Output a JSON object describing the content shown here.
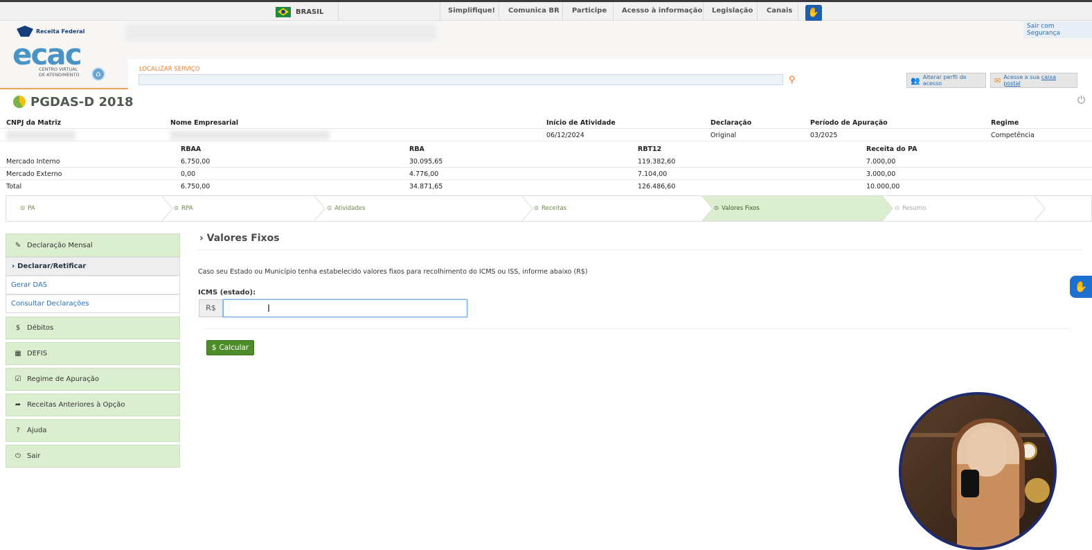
{
  "gov_bar": {
    "brasil": "BRASIL",
    "links": [
      "Simplifique!",
      "Comunica BR",
      "Participe",
      "Acesso à informação",
      "Legislação",
      "Canais"
    ]
  },
  "header": {
    "receita_logo": "Receita Federal",
    "ecac_logo": "ecac",
    "ecac_subtitle_1": "CENTRO VIRTUAL",
    "ecac_subtitle_2": "DE ATENDIMENTO",
    "logout": "Sair com Segurança",
    "search_label": "LOCALIZAR SERVIÇO",
    "search_value": "",
    "profile_button": "Alterar perfil de acesso",
    "mailbox_button_prefix": "Acesse a sua",
    "mailbox_button_link": "caixa postal"
  },
  "page": {
    "title": "PGDAS-D 2018"
  },
  "info": {
    "headers": {
      "cnpj": "CNPJ da Matriz",
      "nome": "Nome Empresarial",
      "inicio": "Início de Atividade",
      "declaracao": "Declaração",
      "periodo": "Período de Apuração",
      "regime": "Regime"
    },
    "values": {
      "inicio": "06/12/2024",
      "declaracao": "Original",
      "periodo": "03/2025",
      "regime": "Competência"
    },
    "revenue_headers": [
      "RBAA",
      "RBA",
      "RBT12",
      "Receita do PA"
    ],
    "revenue_rows": [
      {
        "label": "Mercado Interno",
        "values": [
          "6.750,00",
          "30.095,65",
          "119.382,60",
          "7.000,00"
        ]
      },
      {
        "label": "Mercado Externo",
        "values": [
          "0,00",
          "4.776,00",
          "7.104,00",
          "3.000,00"
        ]
      },
      {
        "label": "Total",
        "values": [
          "6.750,00",
          "34.871,65",
          "126.486,60",
          "10.000,00"
        ]
      }
    ]
  },
  "steps": [
    "PA",
    "RPA",
    "Atividades",
    "Receitas",
    "Valores Fixos",
    "Resumo"
  ],
  "active_step": "Valores Fixos",
  "sidebar": {
    "declaracao_mensal": "Declaração Mensal",
    "declarar_retificar": "Declarar/Retificar",
    "gerar_das": "Gerar DAS",
    "consultar": "Consultar Declarações",
    "debitos": "Débitos",
    "defis": "DEFIS",
    "regime": "Regime de Apuração",
    "receitas_anteriores": "Receitas Anteriores à Opção",
    "ajuda": "Ajuda",
    "sair": "Sair"
  },
  "main": {
    "section_title": "Valores Fixos",
    "instructions": "Caso seu Estado ou Município tenha estabelecido valores fixos para recolhimento do ICMS ou ISS, informe abaixo (R$)",
    "icms_label": "ICMS (estado):",
    "currency": "R$",
    "icms_value": "",
    "calc_button": "Calcular"
  },
  "colors": {
    "accent_green": "#4e8c2a",
    "sidebar_green": "#dbeecf",
    "link_blue": "#2a6db3",
    "orange": "#e87b2a"
  }
}
